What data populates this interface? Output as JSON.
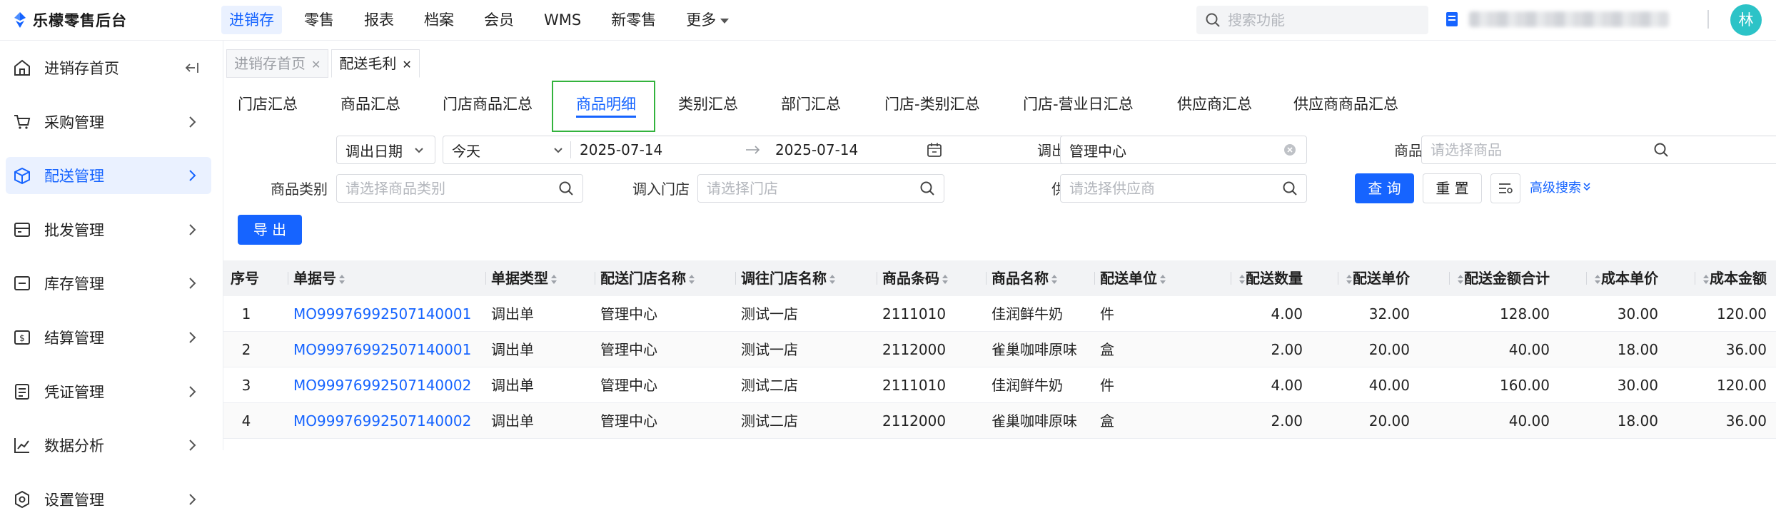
{
  "app": {
    "logo_text": "乐檬零售后台",
    "avatar_text": "林"
  },
  "topnav": {
    "items": [
      "进销存",
      "零售",
      "报表",
      "档案",
      "会员",
      "WMS",
      "新零售",
      "更多"
    ],
    "active_index": 0
  },
  "top_search": {
    "placeholder": "搜索功能"
  },
  "sidebar": {
    "items": [
      {
        "label": "进销存首页",
        "icon": "home-icon"
      },
      {
        "label": "采购管理",
        "icon": "cart-icon"
      },
      {
        "label": "配送管理",
        "icon": "delivery-box-icon"
      },
      {
        "label": "批发管理",
        "icon": "wholesale-icon"
      },
      {
        "label": "库存管理",
        "icon": "inventory-icon"
      },
      {
        "label": "结算管理",
        "icon": "settlement-icon"
      },
      {
        "label": "凭证管理",
        "icon": "voucher-icon"
      },
      {
        "label": "数据分析",
        "icon": "chart-line-icon"
      },
      {
        "label": "设置管理",
        "icon": "settings-icon"
      }
    ],
    "active_index": 2
  },
  "page_tabs": [
    {
      "label": "进销存首页",
      "active": false
    },
    {
      "label": "配送毛利",
      "active": true
    }
  ],
  "sub_tabs": {
    "items": [
      "门店汇总",
      "商品汇总",
      "门店商品汇总",
      "商品明细",
      "类别汇总",
      "部门汇总",
      "门店-类别汇总",
      "门店-营业日汇总",
      "供应商汇总",
      "供应商商品汇总"
    ],
    "active_index": 3
  },
  "filters": {
    "date_label": "日期",
    "date_type": "调出日期",
    "date_range_preset": "今天",
    "date_start": "2025-07-14",
    "date_end": "2025-07-14",
    "out_store_label": "调出门店",
    "out_store_value": "管理中心",
    "product_file_label": "商品档案",
    "product_file_placeholder": "请选择商品",
    "category_label": "商品类别",
    "category_placeholder": "请选择商品类别",
    "in_store_label": "调入门店",
    "in_store_placeholder": "请选择门店",
    "supplier_label": "供应商",
    "supplier_placeholder": "请选择供应商",
    "query_button": "查 询",
    "reset_button": "重 置",
    "advanced_link": "高级搜索"
  },
  "export_button": "导 出",
  "table": {
    "columns": [
      "序号",
      "单据号",
      "单据类型",
      "配送门店名称",
      "调往门店名称",
      "商品条码",
      "商品名称",
      "配送单位",
      "配送数量",
      "配送单价",
      "配送金额合计",
      "成本单价",
      "成本金额"
    ],
    "rows": [
      [
        "1",
        "MO99976992507140001",
        "调出单",
        "管理中心",
        "测试一店",
        "2111010",
        "佳润鲜牛奶",
        "件",
        "4.00",
        "32.00",
        "128.00",
        "30.00",
        "120.00"
      ],
      [
        "2",
        "MO99976992507140001",
        "调出单",
        "管理中心",
        "测试一店",
        "2112000",
        "雀巢咖啡原味",
        "盒",
        "2.00",
        "20.00",
        "40.00",
        "18.00",
        "36.00"
      ],
      [
        "3",
        "MO99976992507140002",
        "调出单",
        "管理中心",
        "测试二店",
        "2111010",
        "佳润鲜牛奶",
        "件",
        "4.00",
        "40.00",
        "160.00",
        "30.00",
        "120.00"
      ],
      [
        "4",
        "MO99976992507140002",
        "调出单",
        "管理中心",
        "测试二店",
        "2112000",
        "雀巢咖啡原味",
        "盒",
        "2.00",
        "20.00",
        "40.00",
        "18.00",
        "36.00"
      ]
    ]
  },
  "colors": {
    "accent": "#1664ff",
    "highlight_box": "#33b33d",
    "avatar": "#2cc3c7"
  }
}
